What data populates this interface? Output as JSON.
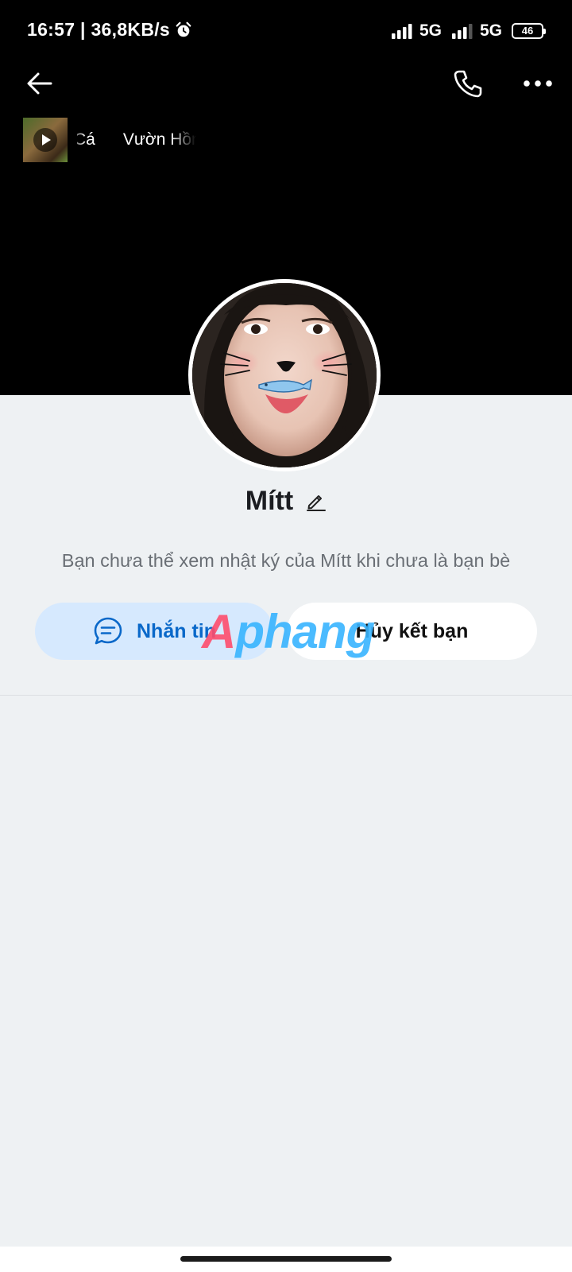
{
  "status_bar": {
    "time_speed": "16:57 | 36,8KB/s",
    "alarm_icon": "alarm-clock-icon",
    "signal_1": "5G",
    "signal_2": "5G",
    "battery": "46"
  },
  "header": {
    "back_icon": "arrow-left-icon",
    "call_icon": "phone-icon",
    "more_icon": "more-horizontal-icon"
  },
  "music": {
    "text": "Cá      Vườn Hồng"
  },
  "profile": {
    "name": "Mítt",
    "diary_notice": "Bạn chưa thể xem nhật ký của Mítt khi chưa là bạn bè"
  },
  "actions": {
    "message_label": "Nhắn tin",
    "unfriend_label": "Hủy kết bạn"
  },
  "watermark": {
    "part_1": "A",
    "part_2": "phang"
  },
  "colors": {
    "cover": "#000000",
    "background": "#eef1f3",
    "message_bg": "#d6e9fe",
    "message_text": "#0a68c9",
    "notice_text": "#6a6f75"
  }
}
